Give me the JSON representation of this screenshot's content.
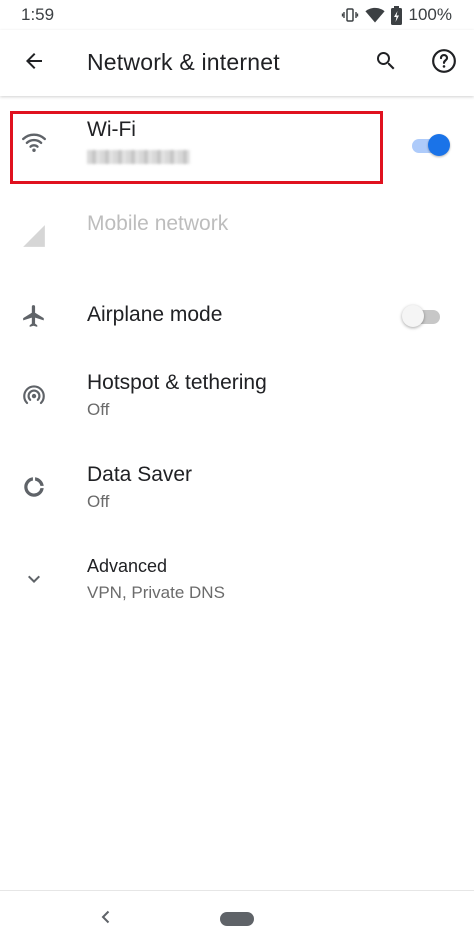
{
  "status_bar": {
    "time": "1:59",
    "battery": "100%",
    "icons": [
      "vibrate-icon",
      "wifi-signal-icon",
      "battery-charging-icon"
    ]
  },
  "app_bar": {
    "title": "Network & internet",
    "icons": [
      "back-arrow-icon",
      "search-icon",
      "help-icon"
    ]
  },
  "items": {
    "wifi": {
      "title": "Wi-Fi",
      "icon": "wifi-icon",
      "toggle_on": true
    },
    "mobile": {
      "title": "Mobile network",
      "icon": "cellular-signal-icon",
      "disabled": true
    },
    "airplane": {
      "title": "Airplane mode",
      "icon": "airplane-icon",
      "toggle_on": false
    },
    "hotspot": {
      "title": "Hotspot & tethering",
      "subtitle": "Off",
      "icon": "hotspot-icon"
    },
    "datasaver": {
      "title": "Data Saver",
      "subtitle": "Off",
      "icon": "data-saver-icon"
    },
    "advanced": {
      "title": "Advanced",
      "subtitle": "VPN, Private DNS",
      "icon": "chevron-down-icon"
    }
  },
  "colors": {
    "accent": "#1a73e8",
    "highlight": "#e0111f",
    "icon": "#5f6368"
  },
  "nav_bar": {
    "icons": [
      "nav-back-icon",
      "home-pill-icon"
    ]
  }
}
